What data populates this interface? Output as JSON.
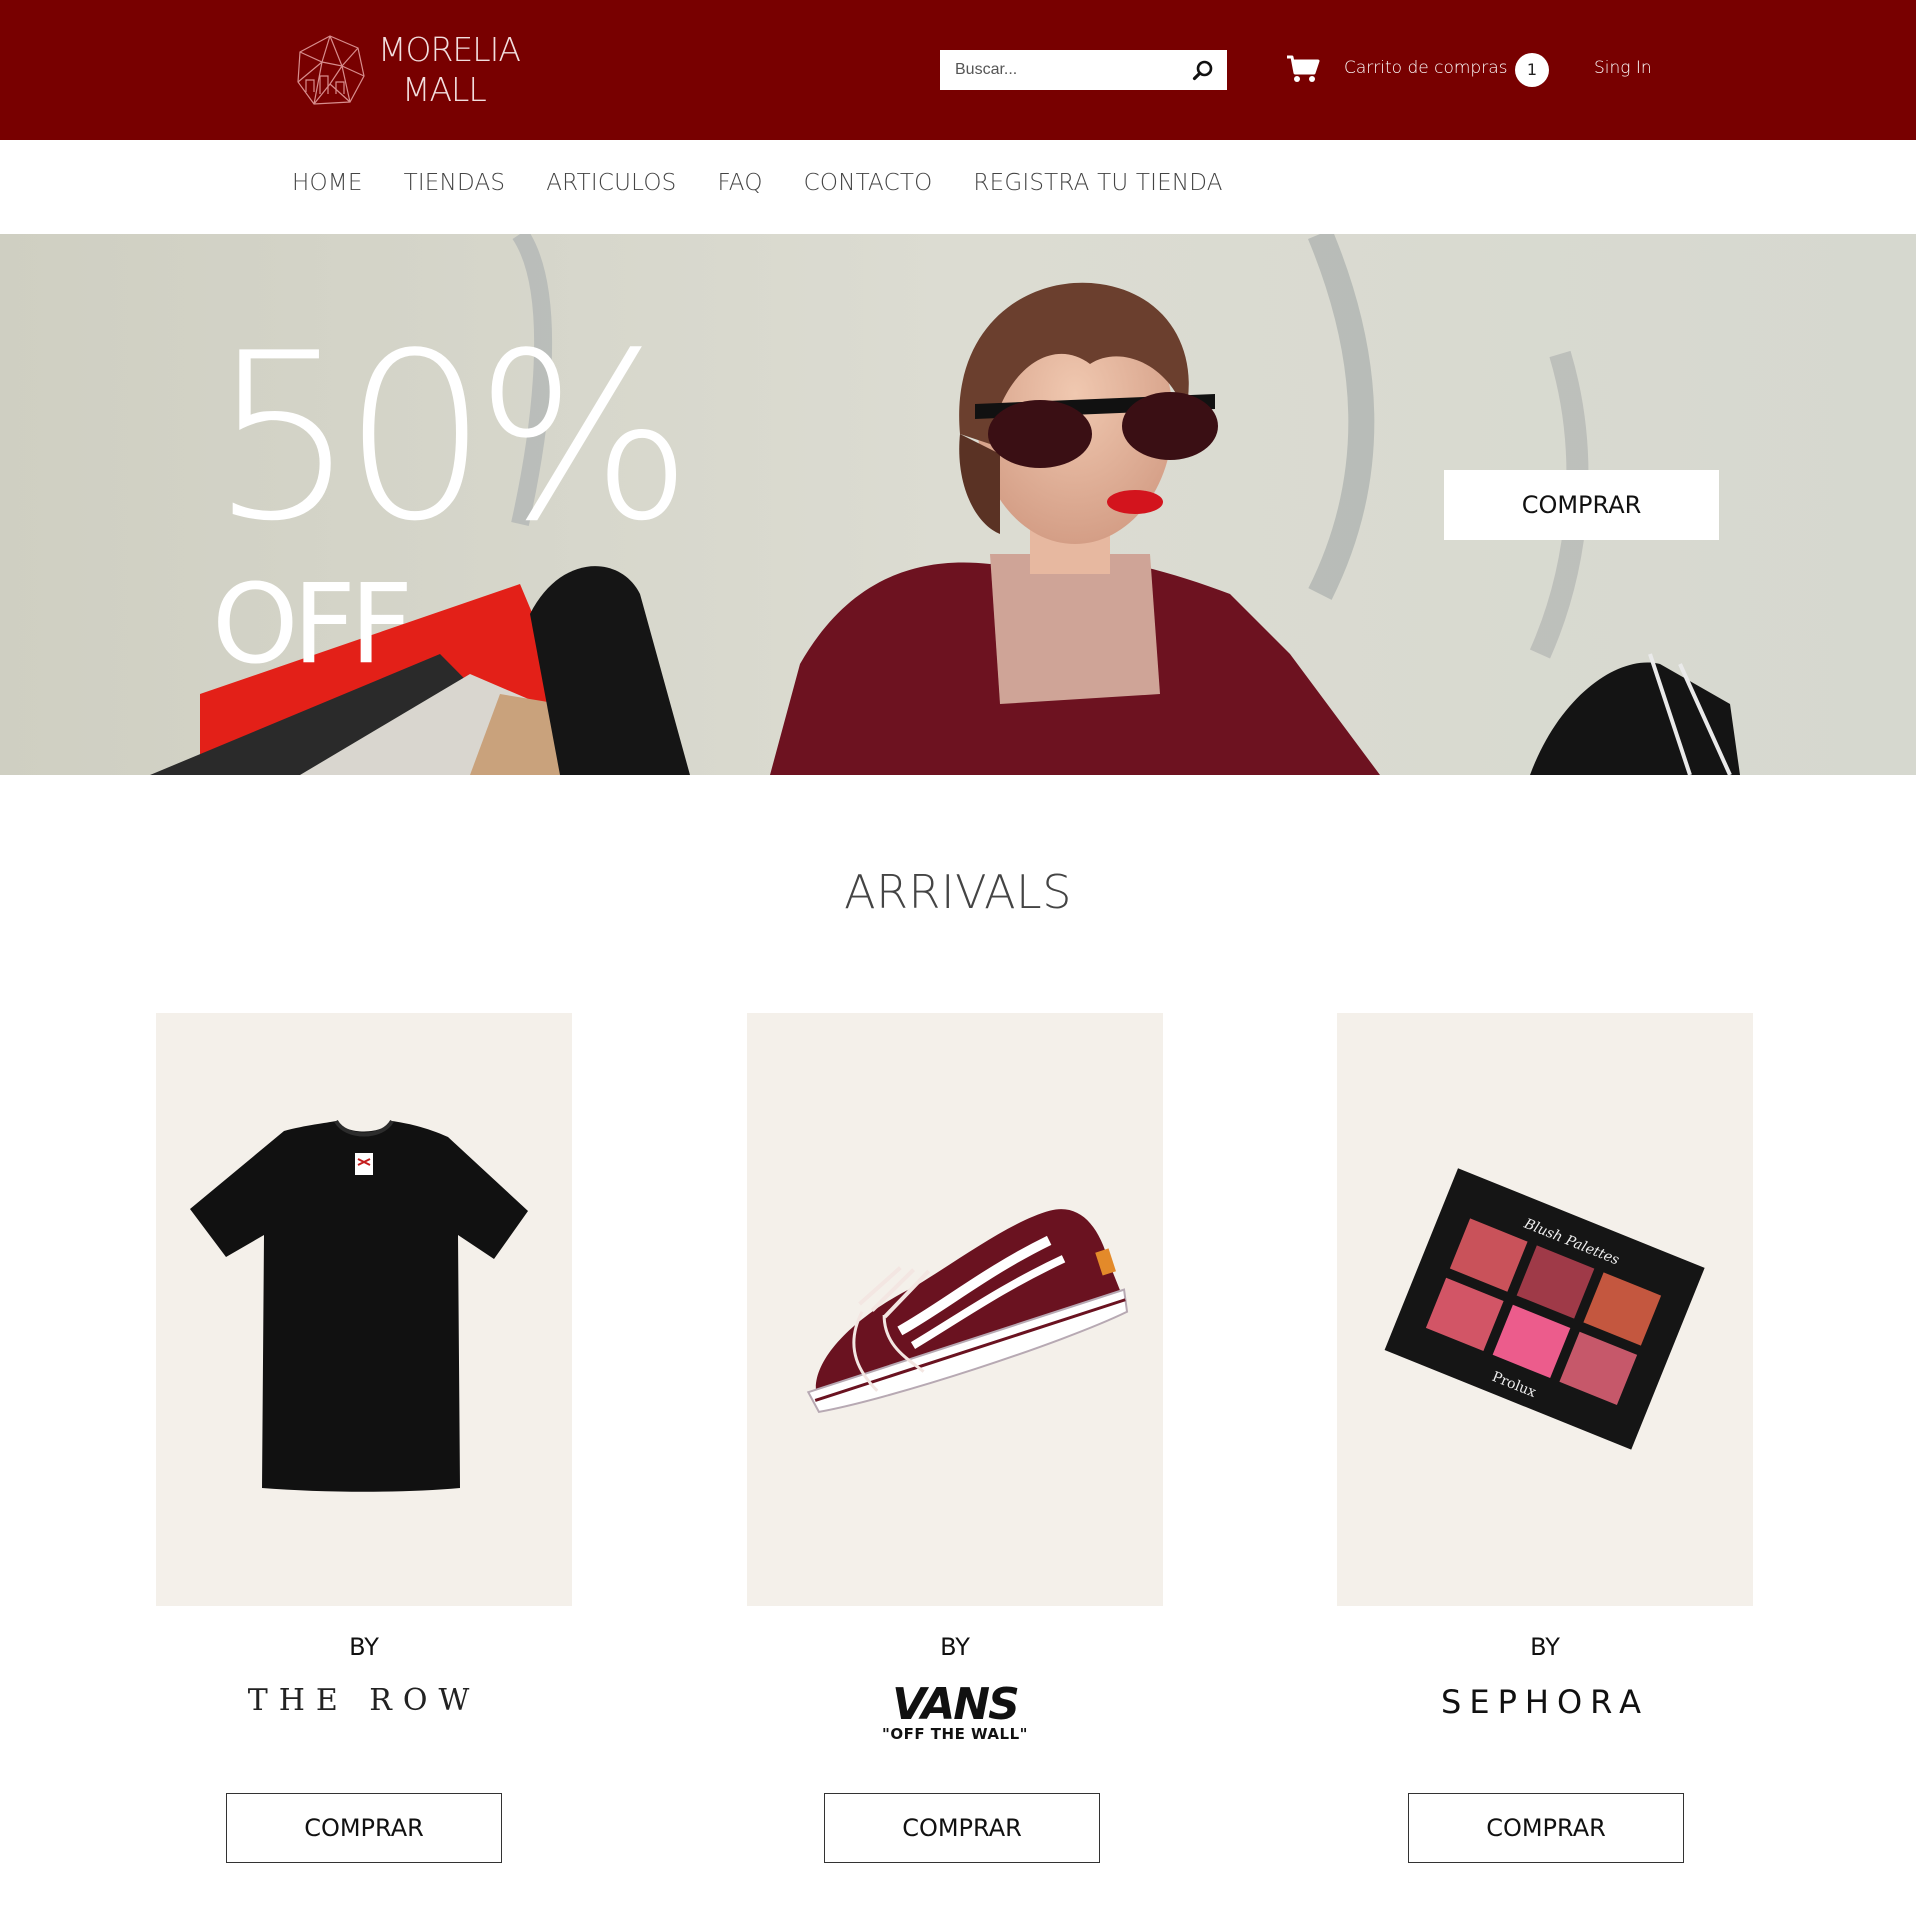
{
  "header": {
    "logo_line1": "MORELIA",
    "logo_line2": "MALL",
    "search_placeholder": "Buscar...",
    "cart_label": "Carrito de compras",
    "cart_count": "1",
    "signin_label": "Sing In"
  },
  "nav": {
    "items": [
      "HOME",
      "TIENDAS",
      "ARTICULOS",
      "FAQ",
      "CONTACTO",
      "REGISTRA TU TIENDA"
    ]
  },
  "hero": {
    "percent": "50%",
    "off": "OFF",
    "cta": "COMPRAR"
  },
  "arrivals": {
    "title": "ARRIVALS",
    "products": [
      {
        "by": "BY",
        "brand": "THE ROW",
        "cta": "COMPRAR",
        "image": "black-tshirt"
      },
      {
        "by": "BY",
        "brand": "VANS",
        "brand_sub": "\"OFF THE WALL\"",
        "cta": "COMPRAR",
        "image": "sneaker"
      },
      {
        "by": "BY",
        "brand": "SEPHORA",
        "cta": "COMPRAR",
        "image": "blush-palette",
        "palette_title": "Blush Palettes",
        "palette_brand": "Prolux"
      }
    ]
  },
  "colors": {
    "header_bg": "#780000",
    "nav_text": "#444444",
    "card_bg": "#f4f0ea"
  }
}
